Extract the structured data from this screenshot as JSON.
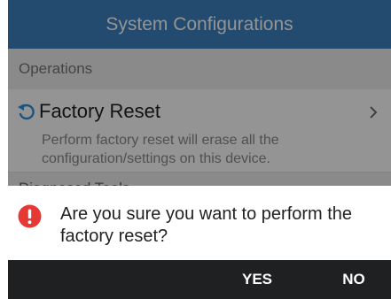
{
  "header": {
    "title": "System Configurations"
  },
  "section": {
    "title": "Operations"
  },
  "row": {
    "title": "Factory Reset",
    "description_line1": "Perform factory reset will erase all the",
    "description_line2": "configuration/settings on this device."
  },
  "next_section": {
    "title": "Diagnosed Tools"
  },
  "dialog": {
    "message_line1": "Are you sure you want to perform the",
    "message_line2": "factory reset?",
    "yes_label": "YES",
    "no_label": "NO"
  },
  "colors": {
    "header_bg": "#3b82c0",
    "accent_icon": "#2f8fd6",
    "alert_red": "#e53935",
    "action_bar": "#1f2021"
  },
  "icons": {
    "reset": "reset-icon",
    "chevron": "chevron-right-icon",
    "alert": "alert-icon"
  }
}
